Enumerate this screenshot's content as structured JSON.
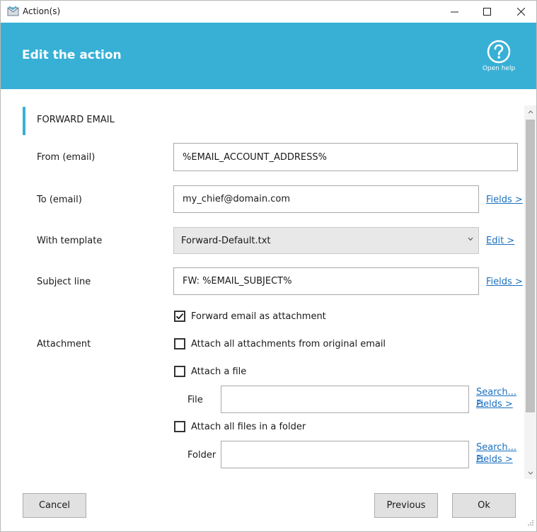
{
  "window": {
    "title": "Action(s)",
    "minimize_icon": "minimize-icon",
    "maximize_icon": "maximize-icon",
    "close_icon": "close-icon"
  },
  "header": {
    "title": "Edit the action",
    "help_label": "Open help",
    "help_icon": "question-circle-icon",
    "background_color": "#38b0d6"
  },
  "section": {
    "title": "FORWARD EMAIL",
    "accent_color": "#38b0d6"
  },
  "form": {
    "from": {
      "label": "From (email)",
      "value": "%EMAIL_ACCOUNT_ADDRESS%"
    },
    "to": {
      "label": "To (email)",
      "value": "my_chief@domain.com",
      "link": "Fields >"
    },
    "template": {
      "label": "With template",
      "value": "Forward-Default.txt",
      "link": "Edit >"
    },
    "subject": {
      "label": "Subject line",
      "value": "FW: %EMAIL_SUBJECT%",
      "link": "Fields >"
    },
    "attachment": {
      "label": "Attachment",
      "forward_as_attachment": {
        "label": "Forward email as attachment",
        "checked": true
      },
      "attach_all_original": {
        "label": "Attach all attachments from original email",
        "checked": false
      },
      "attach_file": {
        "label": "Attach a file",
        "checked": false
      },
      "file": {
        "label": "File",
        "value": "",
        "search_link": "Search... >",
        "fields_link": "Fields >"
      },
      "attach_folder": {
        "label": "Attach all files in a folder",
        "checked": false
      },
      "folder": {
        "label": "Folder",
        "value": "",
        "search_link": "Search... >",
        "fields_link": "Fields >"
      }
    }
  },
  "footer": {
    "cancel_label": "Cancel",
    "previous_label": "Previous",
    "ok_label": "Ok"
  },
  "colors": {
    "link": "#1a6fbf",
    "button_bg": "#e1e1e1"
  }
}
